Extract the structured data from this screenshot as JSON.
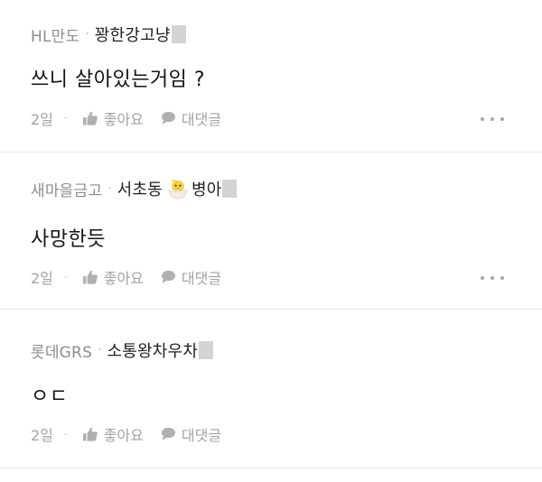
{
  "comments": [
    {
      "company": "HL만도",
      "nickname": "꽝한강고냥",
      "text": "쓰니 살아있는거임 ?",
      "time": "2일",
      "like_label": "좋아요",
      "reply_label": "대댓글"
    },
    {
      "company": "새마을금고",
      "nickname_part1": "서초동",
      "nickname_part2": "병아",
      "text": "사망한듯",
      "time": "2일",
      "like_label": "좋아요",
      "reply_label": "대댓글"
    },
    {
      "company": "롯데GRS",
      "nickname": "소통왕차우차",
      "text": "ㅇㄷ",
      "time": "2일",
      "like_label": "좋아요",
      "reply_label": "대댓글"
    }
  ],
  "separator": "·",
  "icons": {
    "like": "thumbs-up-icon",
    "reply": "speech-bubble-icon",
    "more": "more-dots-icon",
    "badge": "hatching-chick-icon"
  },
  "colors": {
    "text_primary": "#141414",
    "text_muted": "#a3a3a3",
    "company": "#8c8c8c",
    "divider": "#e6e6e6"
  }
}
